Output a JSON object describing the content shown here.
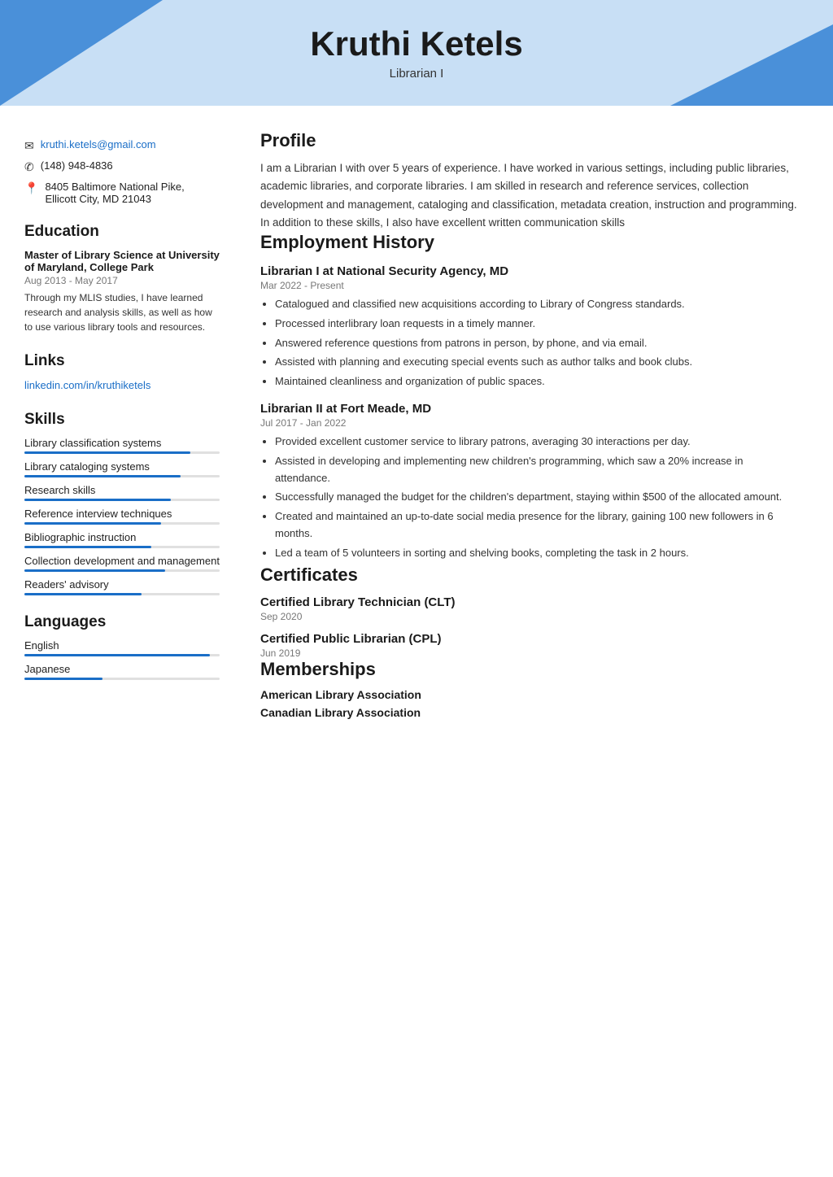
{
  "header": {
    "name": "Kruthi Ketels",
    "title": "Librarian I"
  },
  "contact": {
    "email": "kruthi.ketels@gmail.com",
    "phone": "(148) 948-4836",
    "address_line1": "8405 Baltimore National Pike,",
    "address_line2": "Ellicott City, MD 21043"
  },
  "education": {
    "section_title": "Education",
    "degree": "Master of Library Science at University of Maryland, College Park",
    "date": "Aug 2013 - May 2017",
    "description": "Through my MLIS studies, I have learned research and analysis skills, as well as how to use various library tools and resources."
  },
  "links": {
    "section_title": "Links",
    "url_display": "linkedin.com/in/kruthiketels",
    "url_href": "https://linkedin.com/in/kruthiketels"
  },
  "skills": {
    "section_title": "Skills",
    "items": [
      {
        "label": "Library classification systems",
        "width": "85%"
      },
      {
        "label": "Library cataloging systems",
        "width": "80%"
      },
      {
        "label": "Research skills",
        "width": "75%"
      },
      {
        "label": "Reference interview techniques",
        "width": "70%"
      },
      {
        "label": "Bibliographic instruction",
        "width": "65%"
      },
      {
        "label": "Collection development and management",
        "width": "72%"
      },
      {
        "label": "Readers' advisory",
        "width": "60%"
      }
    ]
  },
  "languages": {
    "section_title": "Languages",
    "items": [
      {
        "label": "English",
        "width": "95%"
      },
      {
        "label": "Japanese",
        "width": "40%"
      }
    ]
  },
  "profile": {
    "section_title": "Profile",
    "text": "I am a Librarian I with over 5 years of experience. I have worked in various settings, including public libraries, academic libraries, and corporate libraries. I am skilled in research and reference services, collection development and management, cataloging and classification, metadata creation, instruction and programming. In addition to these skills, I also have excellent written communication skills"
  },
  "employment": {
    "section_title": "Employment History",
    "jobs": [
      {
        "title": "Librarian I at National Security Agency, MD",
        "date": "Mar 2022 - Present",
        "bullets": [
          "Catalogued and classified new acquisitions according to Library of Congress standards.",
          "Processed interlibrary loan requests in a timely manner.",
          "Answered reference questions from patrons in person, by phone, and via email.",
          "Assisted with planning and executing special events such as author talks and book clubs.",
          "Maintained cleanliness and organization of public spaces."
        ]
      },
      {
        "title": "Librarian II at Fort Meade, MD",
        "date": "Jul 2017 - Jan 2022",
        "bullets": [
          "Provided excellent customer service to library patrons, averaging 30 interactions per day.",
          "Assisted in developing and implementing new children's programming, which saw a 20% increase in attendance.",
          "Successfully managed the budget for the children's department, staying within $500 of the allocated amount.",
          "Created and maintained an up-to-date social media presence for the library, gaining 100 new followers in 6 months.",
          "Led a team of 5 volunteers in sorting and shelving books, completing the task in 2 hours."
        ]
      }
    ]
  },
  "certificates": {
    "section_title": "Certificates",
    "items": [
      {
        "title": "Certified Library Technician (CLT)",
        "date": "Sep 2020"
      },
      {
        "title": "Certified Public Librarian (CPL)",
        "date": "Jun 2019"
      }
    ]
  },
  "memberships": {
    "section_title": "Memberships",
    "items": [
      "American Library Association",
      "Canadian Library Association"
    ]
  }
}
